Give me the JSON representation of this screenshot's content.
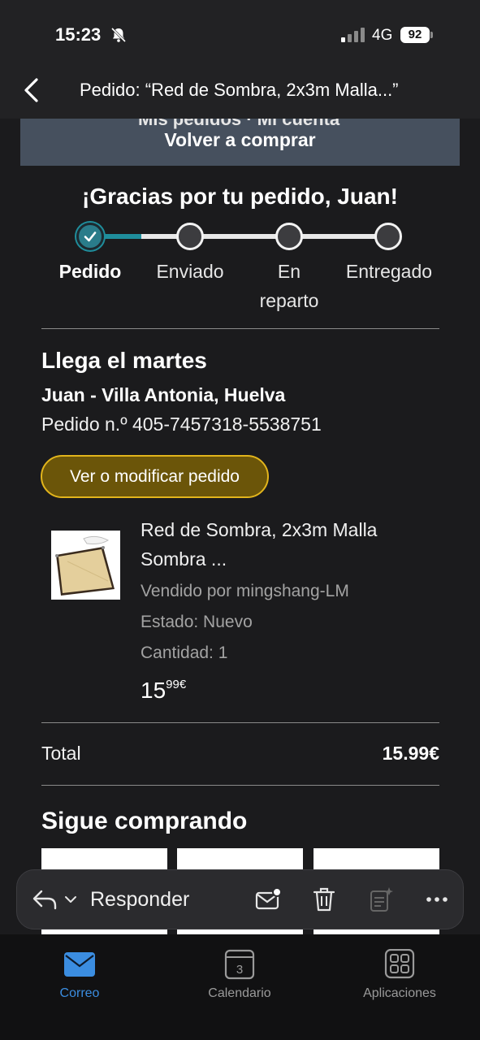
{
  "status": {
    "time": "15:23",
    "network": "4G",
    "battery": "92"
  },
  "nav": {
    "title": "Pedido: “Red de Sombra, 2x3m Malla...”"
  },
  "banner": {
    "label": "Volver a comprar"
  },
  "thanks": "¡Gracias por tu pedido, Juan!",
  "progress": {
    "steps": [
      "Pedido",
      "Enviado",
      "En reparto",
      "Entregado"
    ],
    "current": 0
  },
  "delivery": {
    "arrives": "Llega el martes",
    "address": "Juan - Villa Antonia, Huelva",
    "order_number": "Pedido n.º 405-7457318-5538751",
    "modify_label": "Ver o modificar pedido"
  },
  "product": {
    "name": "Red de Sombra, 2x3m Malla Sombra ...",
    "seller": "Vendido por mingshang-LM",
    "condition": "Estado: Nuevo",
    "quantity": "Cantidad: 1",
    "price_whole": "15",
    "price_fraction": "99€"
  },
  "total": {
    "label": "Total",
    "value": "15.99€"
  },
  "recommendations": {
    "title": "Sigue comprando"
  },
  "reply_bar": {
    "reply_label": "Responder"
  },
  "tabs": [
    {
      "label": "Correo",
      "icon": "mail-icon"
    },
    {
      "label": "Calendario",
      "icon": "calendar-icon",
      "badge": "3"
    },
    {
      "label": "Aplicaciones",
      "icon": "apps-icon"
    }
  ],
  "colors": {
    "accent": "#1f8e9c",
    "button": "#6b5509",
    "button_border": "#e2b51c",
    "tab_active": "#3b8de0"
  }
}
